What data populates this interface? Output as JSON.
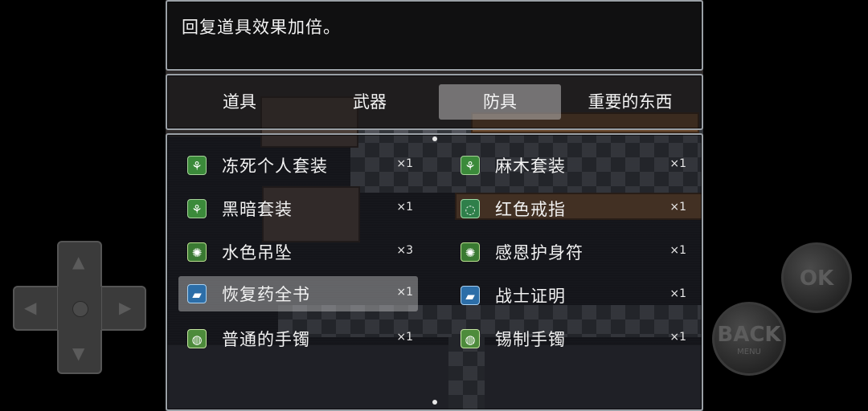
{
  "help": {
    "text": "回复道具效果加倍。"
  },
  "categories": [
    {
      "label": "道具",
      "selected": false
    },
    {
      "label": "武器",
      "selected": false
    },
    {
      "label": "防具",
      "selected": true
    },
    {
      "label": "重要的东西",
      "selected": false
    }
  ],
  "items": [
    {
      "name": "冻死个人套装",
      "qty": "×1",
      "icon": "armor-icon"
    },
    {
      "name": "麻木套装",
      "qty": "×1",
      "icon": "armor-icon"
    },
    {
      "name": "黑暗套装",
      "qty": "×1",
      "icon": "armor-icon"
    },
    {
      "name": "红色戒指",
      "qty": "×1",
      "icon": "ring-icon"
    },
    {
      "name": "水色吊坠",
      "qty": "×3",
      "icon": "amulet-icon"
    },
    {
      "name": "感恩护身符",
      "qty": "×1",
      "icon": "amulet-icon"
    },
    {
      "name": "恢复药全书",
      "qty": "×1",
      "icon": "book-icon",
      "selected": true
    },
    {
      "name": "战士证明",
      "qty": "×1",
      "icon": "book-icon"
    },
    {
      "name": "普通的手镯",
      "qty": "×1",
      "icon": "bracelet-icon"
    },
    {
      "name": "锡制手镯",
      "qty": "×1",
      "icon": "bracelet-icon"
    }
  ],
  "controls": {
    "ok_label": "OK",
    "back_label": "BACK",
    "menu_label": "MENU"
  }
}
